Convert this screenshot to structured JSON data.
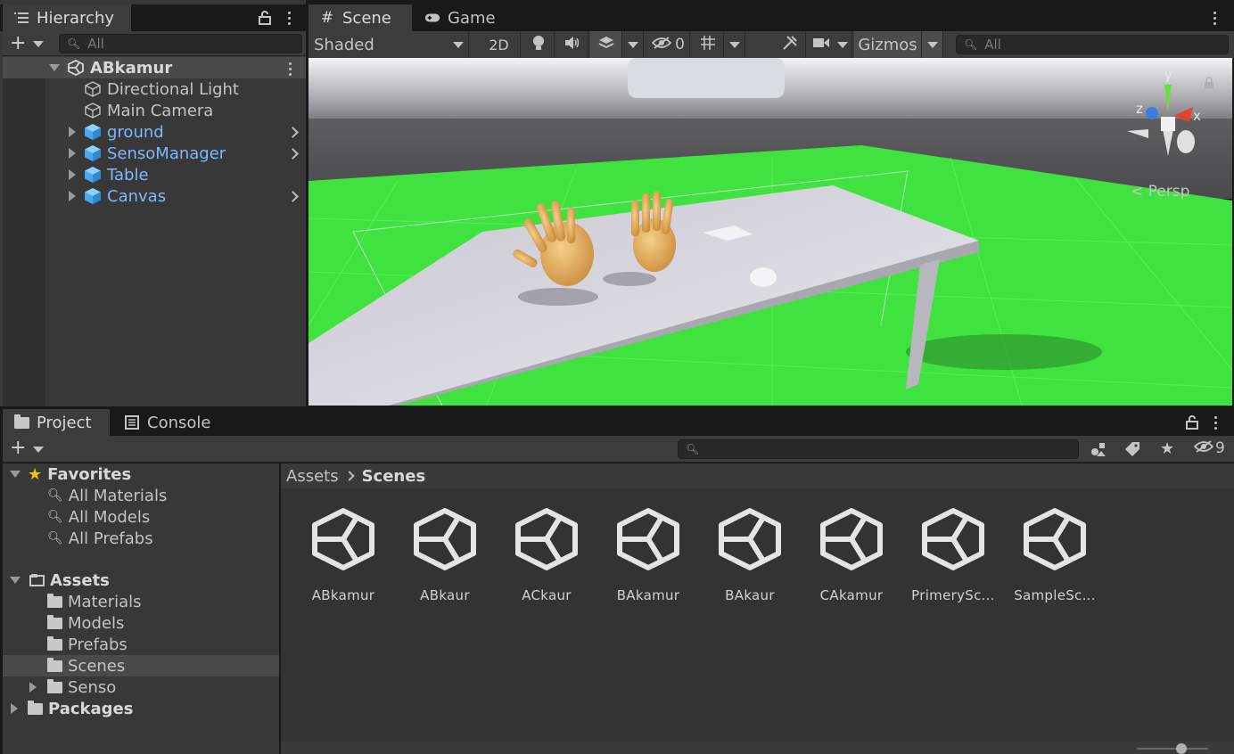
{
  "hierarchy": {
    "tab_label": "Hierarchy",
    "search_placeholder": "All",
    "scene_name": "ABkamur",
    "items": [
      {
        "label": "Directional Light",
        "type": "gameobject"
      },
      {
        "label": "Main Camera",
        "type": "gameobject"
      },
      {
        "label": "ground",
        "type": "prefab"
      },
      {
        "label": "SensoManager",
        "type": "prefab"
      },
      {
        "label": "Table",
        "type": "prefab"
      },
      {
        "label": "Canvas",
        "type": "prefab"
      }
    ]
  },
  "scene_view": {
    "tabs": [
      {
        "label": "Scene"
      },
      {
        "label": "Game"
      }
    ],
    "shading_mode": "Shaded",
    "mode_2d": "2D",
    "hidden_count": "0",
    "gizmos_label": "Gizmos",
    "search_placeholder": "All",
    "gizmo_axes": {
      "y": "y",
      "x": "x",
      "z": "z"
    },
    "projection_label": "< Persp",
    "colors": {
      "ground": "#3fe23f",
      "sky": "#c8c8c8",
      "table": "#dcdae4",
      "hands": "#e8b060"
    }
  },
  "project": {
    "tabs": [
      {
        "label": "Project"
      },
      {
        "label": "Console"
      }
    ],
    "hidden_packages_count": "9",
    "favorites_label": "Favorites",
    "favorites": [
      "All Materials",
      "All Models",
      "All Prefabs"
    ],
    "assets_label": "Assets",
    "asset_folders": [
      "Materials",
      "Models",
      "Prefabs",
      "Scenes",
      "Senso"
    ],
    "packages_label": "Packages",
    "breadcrumb": {
      "root": "Assets",
      "current": "Scenes"
    },
    "files": [
      "ABkamur",
      "ABkaur",
      "ACkaur",
      "BAkamur",
      "BAkaur",
      "CAkamur",
      "PrimerySc...",
      "SampleSc..."
    ]
  }
}
